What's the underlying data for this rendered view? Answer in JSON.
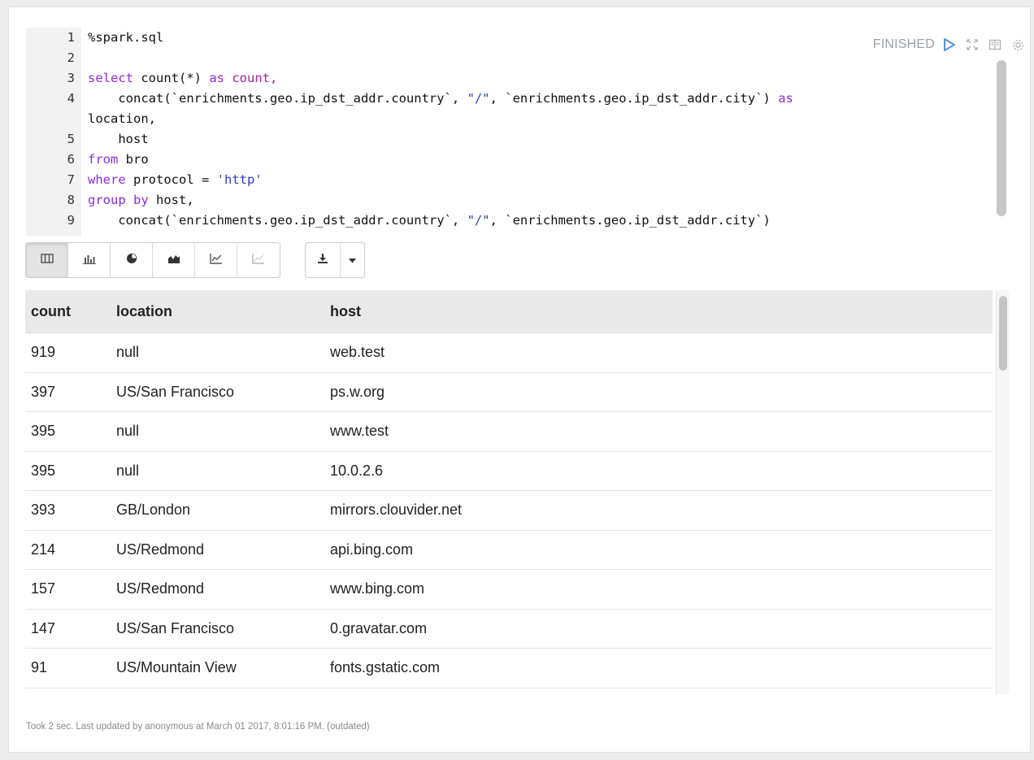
{
  "paragraph": {
    "status": "FINISHED",
    "controls": [
      "run-icon",
      "expand-icon",
      "book-icon",
      "gear-icon"
    ]
  },
  "editor": {
    "lines": [
      {
        "n": "1",
        "parts": [
          {
            "t": "%spark.sql",
            "c": ""
          }
        ]
      },
      {
        "n": "2",
        "parts": [
          {
            "t": "",
            "c": ""
          }
        ]
      },
      {
        "n": "3",
        "parts": [
          {
            "t": "select ",
            "c": "kw"
          },
          {
            "t": "count(*) ",
            "c": ""
          },
          {
            "t": "as ",
            "c": "kw"
          },
          {
            "t": "count,",
            "c": "kw2"
          }
        ]
      },
      {
        "n": "4",
        "parts": [
          {
            "t": "    concat(`enrichments.geo.ip_dst_addr.country`, ",
            "c": ""
          },
          {
            "t": "\"/\"",
            "c": "str"
          },
          {
            "t": ", `enrichments.geo.ip_dst_addr.city`) ",
            "c": ""
          },
          {
            "t": "as",
            "c": "kw"
          }
        ]
      },
      {
        "n": "",
        "parts": [
          {
            "t": "location,",
            "c": ""
          }
        ]
      },
      {
        "n": "5",
        "parts": [
          {
            "t": "    host",
            "c": ""
          }
        ]
      },
      {
        "n": "6",
        "parts": [
          {
            "t": "from ",
            "c": "kw"
          },
          {
            "t": "bro",
            "c": ""
          }
        ]
      },
      {
        "n": "7",
        "parts": [
          {
            "t": "where ",
            "c": "kw"
          },
          {
            "t": "protocol = ",
            "c": ""
          },
          {
            "t": "'http'",
            "c": "str"
          }
        ]
      },
      {
        "n": "8",
        "parts": [
          {
            "t": "group ",
            "c": "kw"
          },
          {
            "t": "by ",
            "c": "kw"
          },
          {
            "t": "host,",
            "c": ""
          }
        ]
      },
      {
        "n": "9",
        "parts": [
          {
            "t": "    concat(`enrichments.geo.ip_dst_addr.country`, ",
            "c": ""
          },
          {
            "t": "\"/\"",
            "c": "str"
          },
          {
            "t": ", `enrichments.geo.ip_dst_addr.city`)",
            "c": ""
          }
        ]
      }
    ]
  },
  "toolbar": {
    "visualizations": [
      "table-icon",
      "bar-chart-icon",
      "pie-chart-icon",
      "area-chart-icon",
      "line-chart-icon",
      "scatter-chart-icon"
    ],
    "active": "table-icon",
    "download": "download-icon",
    "caret": "caret-down-icon"
  },
  "table": {
    "columns": [
      "count",
      "location",
      "host"
    ],
    "rows": [
      [
        "919",
        "null",
        "web.test"
      ],
      [
        "397",
        "US/San Francisco",
        "ps.w.org"
      ],
      [
        "395",
        "null",
        "www.test"
      ],
      [
        "395",
        "null",
        "10.0.2.6"
      ],
      [
        "393",
        "GB/London",
        "mirrors.clouvider.net"
      ],
      [
        "214",
        "US/Redmond",
        "api.bing.com"
      ],
      [
        "157",
        "US/Redmond",
        "www.bing.com"
      ],
      [
        "147",
        "US/San Francisco",
        "0.gravatar.com"
      ],
      [
        "91",
        "US/Mountain View",
        "fonts.gstatic.com"
      ]
    ]
  },
  "footer": {
    "text": "Took 2 sec. Last updated by anonymous at March 01 2017, 8:01:16 PM. (outdated)"
  },
  "colors": {
    "run": "#5b8fe0",
    "icon": "#b5b5b5",
    "keyword": "#8a2be2",
    "string": "#2a3cc8"
  }
}
